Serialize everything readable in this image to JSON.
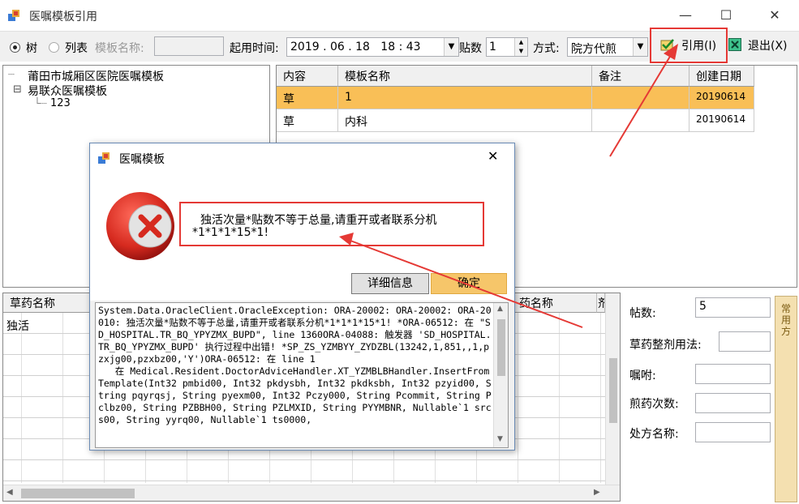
{
  "window": {
    "title": "医嘱模板引用",
    "min_glyph": "—",
    "max_glyph": "☐",
    "close_glyph": "✕"
  },
  "toolbar": {
    "tree_label": "树",
    "list_label": "列表",
    "template_name_label": "模板名称:",
    "template_name_value": "",
    "start_time_label": "起用时间:",
    "start_time_value": "2019 . 06 . 18   18 : 43",
    "dose_label": "贴数",
    "dose_value": "1",
    "mode_label": "方式:",
    "mode_value": "院方代煎",
    "cite_label": "引用(I)",
    "exit_label": "退出(X)",
    "cite_icon": "check-icon",
    "exit_icon": "close-box-icon"
  },
  "tree": {
    "items": [
      {
        "label": "莆田市城厢区医院医嘱模板",
        "prefix": "┈"
      },
      {
        "label": "易联众医嘱模板",
        "prefix": "⊟"
      },
      {
        "label": "123",
        "prefix": "└┈"
      }
    ]
  },
  "template_grid": {
    "headers": [
      "内容",
      "模板名称",
      "备注",
      "创建日期"
    ],
    "rows": [
      {
        "content": "草",
        "name": "1",
        "note": "",
        "date": "20190614",
        "selected": true
      },
      {
        "content": "草",
        "name": "内科",
        "note": "",
        "date": "20190614",
        "selected": false
      }
    ]
  },
  "herb_grid": {
    "headers": [
      "草药名称",
      "药名称",
      "剂"
    ],
    "rows": [
      [
        "独活"
      ]
    ]
  },
  "right_form": {
    "dose_label": "帖数:",
    "dose_value": "5",
    "usage_label": "草药整剂用法:",
    "advice_label": "嘱咐:",
    "decoct_label": "煎药次数:",
    "prescription_label": "处方名称:",
    "side_tab": "常用方"
  },
  "dialog": {
    "title": "医嘱模板",
    "close_glyph": "✕",
    "message_line1": "独活次量*贴数不等于总量,请重开或者联系分机",
    "message_line2": "*1*1*1*15*1!",
    "detail_button": "详细信息",
    "ok_button": "确定",
    "detail_text": "System.Data.OracleClient.OracleException: ORA-20002: ORA-20002: ORA-20010: 独活次量*贴数不等于总量,请重开或者联系分机*1*1*1*15*1! *ORA-06512: 在 \"SD_HOSPITAL.TR_BQ_YPYZMX_BUPD\", line 1360ORA-04088: 触发器 'SD_HOSPITAL.TR_BQ_YPYZMX_BUPD' 执行过程中出错! *SP_ZS_YZMBYY_ZYDZBL(13242,1,851,,1,pzxjg00,pzxbz00,'Y')ORA-06512: 在 line 1\n   在 Medical.Resident.DoctorAdviceHandler.XT_YZMBLBHandler.InsertFromTemplate(Int32 pmbid00, Int32 pkdysbh, Int32 pkdksbh, Int32 pzyid00, String pqyrqsj, String pyexm00, Int32 Pczy000, String Pcommit, String Pclbz00, String PZBBH00, String PZLMXID, String PYYMBNR, Nullable`1 srcs00, String yyrq00, Nullable`1 ts0000,"
  },
  "colors": {
    "accent_red": "#e53935",
    "selected_row": "#f9bf57",
    "ok_button": "#f6c66a"
  }
}
